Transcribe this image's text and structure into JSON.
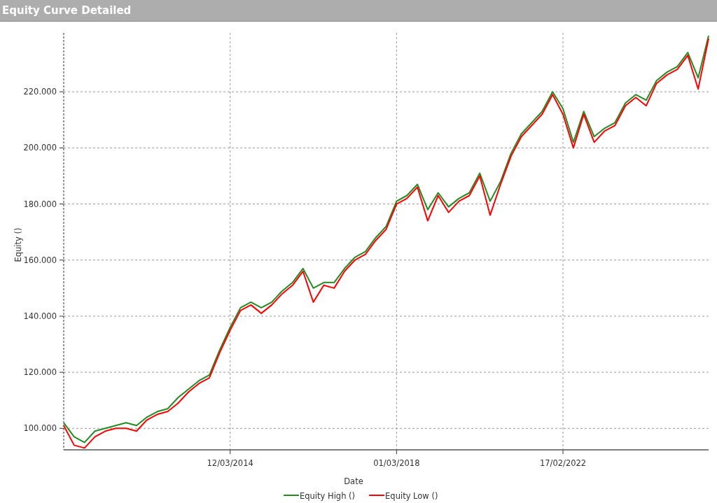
{
  "panel": {
    "title": "Equity Curve Detailed"
  },
  "chart": {
    "chart_data": {
      "type": "line",
      "xlabel": "Date",
      "ylabel": "Equity ()",
      "categories": [
        null,
        null,
        null,
        null,
        null,
        null,
        null,
        null,
        null,
        null,
        null,
        null,
        null,
        null,
        null,
        null,
        "12/03/2014",
        null,
        null,
        null,
        null,
        null,
        null,
        null,
        null,
        null,
        null,
        null,
        null,
        null,
        null,
        null,
        "01/03/2018",
        null,
        null,
        null,
        null,
        null,
        null,
        null,
        null,
        null,
        null,
        null,
        null,
        null,
        null,
        null,
        "17/02/2022",
        null,
        null,
        null,
        null,
        null,
        null,
        null,
        null,
        null,
        null,
        null,
        null,
        null,
        null
      ],
      "series": [
        {
          "name": "Equity High ()",
          "color": "#228b22",
          "values": [
            102,
            97,
            95,
            99,
            100,
            101,
            102,
            101,
            104,
            106,
            107,
            111,
            114,
            117,
            119,
            128,
            136,
            143,
            145,
            143,
            145,
            149,
            152,
            157,
            150,
            152,
            152,
            157,
            161,
            163,
            168,
            172,
            181,
            183,
            187,
            178,
            184,
            179,
            182,
            184,
            191,
            181,
            188,
            198,
            205,
            209,
            213,
            220,
            214,
            202,
            213,
            204,
            207,
            209,
            216,
            219,
            217,
            224,
            227,
            229,
            234,
            225,
            240
          ]
        },
        {
          "name": "Equity Low ()",
          "color": "#ff0000",
          "values": [
            101,
            94,
            93,
            97,
            99,
            100,
            100,
            99,
            103,
            105,
            106,
            109,
            113,
            116,
            118,
            127,
            135,
            142,
            144,
            141,
            144,
            148,
            151,
            156,
            145,
            151,
            150,
            156,
            160,
            162,
            167,
            171,
            180,
            182,
            186,
            174,
            183,
            177,
            181,
            183,
            190,
            176,
            187,
            197,
            204,
            208,
            212,
            219,
            212,
            200,
            212,
            202,
            206,
            208,
            215,
            218,
            215,
            223,
            226,
            228,
            233,
            221,
            239
          ]
        }
      ],
      "ylim": [
        92.35,
        241
      ],
      "grid": true,
      "legend": "bottom",
      "yticks": [
        {
          "value": 100,
          "label": "100.000"
        },
        {
          "value": 120,
          "label": "120.000"
        },
        {
          "value": 140,
          "label": "140.000"
        },
        {
          "value": 160,
          "label": "160.000"
        },
        {
          "value": 180,
          "label": "180.000"
        },
        {
          "value": 200,
          "label": "200.000"
        },
        {
          "value": 220,
          "label": "220.000"
        }
      ]
    }
  }
}
